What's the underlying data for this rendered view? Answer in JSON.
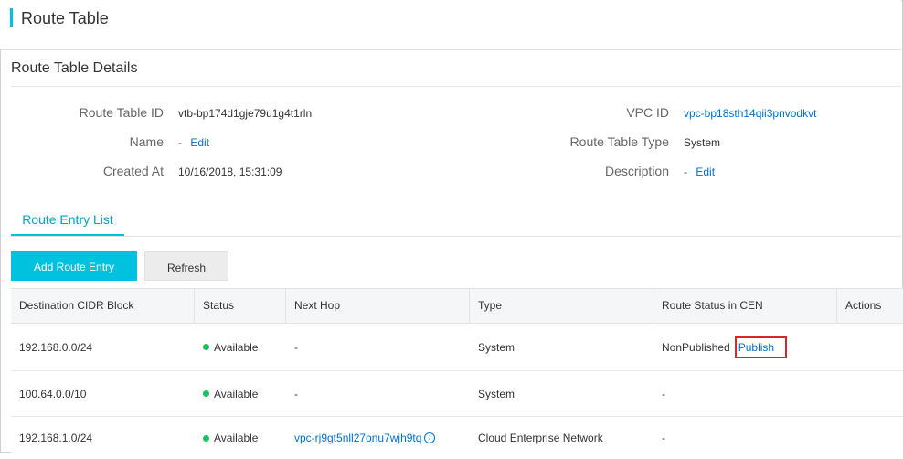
{
  "page": {
    "title": "Route Table"
  },
  "details": {
    "section_title": "Route Table Details",
    "route_table_id": {
      "label": "Route Table ID",
      "value": "vtb-bp174d1gje79u1g4t1rln"
    },
    "name": {
      "label": "Name",
      "value": "-",
      "action": "Edit"
    },
    "created_at": {
      "label": "Created At",
      "value": "10/16/2018, 15:31:09"
    },
    "vpc_id": {
      "label": "VPC ID",
      "value": "vpc-bp18sth14qii3pnvodkvt"
    },
    "route_table_type": {
      "label": "Route Table Type",
      "value": "System"
    },
    "description": {
      "label": "Description",
      "value": "-",
      "action": "Edit"
    }
  },
  "tabs": [
    {
      "label": "Route Entry List",
      "active": true
    }
  ],
  "toolbar": {
    "add_label": "Add Route Entry",
    "refresh_label": "Refresh"
  },
  "table": {
    "headers": [
      "Destination CIDR Block",
      "Status",
      "Next Hop",
      "Type",
      "Route Status in CEN",
      "Actions"
    ],
    "rows": [
      {
        "cidr": "192.168.0.0/24",
        "status": "Available",
        "next_hop": "-",
        "type": "System",
        "cen_status": "NonPublished",
        "cen_action": "Publish"
      },
      {
        "cidr": "100.64.0.0/10",
        "status": "Available",
        "next_hop": "-",
        "type": "System",
        "cen_status": "-",
        "cen_action": ""
      },
      {
        "cidr": "192.168.1.0/24",
        "status": "Available",
        "next_hop": "vpc-rj9gt5nll27onu7wjh9tq",
        "type": "Cloud Enterprise Network",
        "cen_status": "-",
        "cen_action": ""
      }
    ]
  },
  "colors": {
    "accent": "#00c1de",
    "link": "#0070cc",
    "status_ok": "#1fbf5f",
    "highlight": "#d9262c"
  },
  "icons": {
    "info": "info-circle-icon",
    "status": "status-dot-icon"
  }
}
